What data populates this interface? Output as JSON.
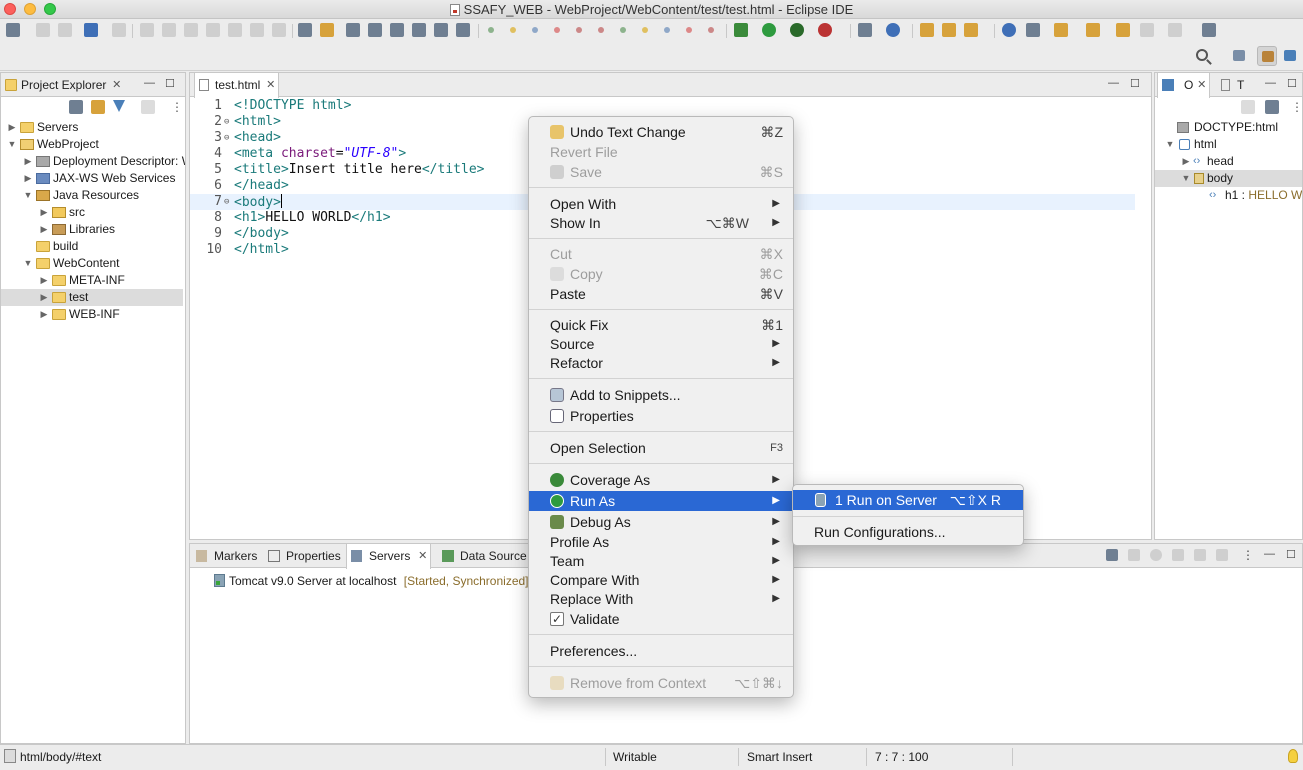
{
  "window": {
    "title": "SSAFY_WEB - WebProject/WebContent/test/test.html - Eclipse IDE"
  },
  "explorer": {
    "tab_label": "Project Explorer",
    "items": [
      {
        "label": "Servers",
        "icon": "folder-icon"
      },
      {
        "label": "WebProject",
        "icon": "project-icon"
      },
      {
        "label": "Deployment Descriptor: WebProject",
        "icon": "deployment-descriptor-icon"
      },
      {
        "label": "JAX-WS Web Services",
        "icon": "web-services-icon"
      },
      {
        "label": "Java Resources",
        "icon": "java-resources-icon"
      },
      {
        "label": "src",
        "icon": "source-folder-icon"
      },
      {
        "label": "Libraries",
        "icon": "libraries-icon"
      },
      {
        "label": "build",
        "icon": "folder-icon"
      },
      {
        "label": "WebContent",
        "icon": "folder-icon"
      },
      {
        "label": "META-INF",
        "icon": "folder-icon"
      },
      {
        "label": "test",
        "icon": "folder-icon"
      },
      {
        "label": "WEB-INF",
        "icon": "folder-icon"
      }
    ]
  },
  "editor": {
    "tab_label": "test.html",
    "line_numbers": [
      "1",
      "2",
      "3",
      "4",
      "5",
      "6",
      "7",
      "8",
      "9",
      "10"
    ],
    "lines": [
      {
        "t1": "<!DOCTYPE html>"
      },
      {
        "t1": "<html>"
      },
      {
        "t1": "<head>"
      },
      {
        "t1": "<meta ",
        "a1": "charset",
        "t2": "=",
        "s1": "\"UTF-8\"",
        "t3": ">"
      },
      {
        "t1": "<title>",
        "x1": "Insert title here",
        "t2": "</title>"
      },
      {
        "t1": "</head>"
      },
      {
        "t1": "<body>"
      },
      {
        "t1": "<h1>",
        "x1": "HELLO WORLD",
        "t2": "</h1>"
      },
      {
        "t1": "</body>"
      },
      {
        "t1": "</html>"
      }
    ]
  },
  "outline": {
    "tab1": "O",
    "tab2": "T",
    "items": [
      {
        "label": "DOCTYPE:html"
      },
      {
        "label": "html"
      },
      {
        "label": "head"
      },
      {
        "label": "body"
      },
      {
        "label": "h1 : ",
        "value": "HELLO WORLD"
      }
    ]
  },
  "bottom": {
    "tabs": [
      "Markers",
      "Properties",
      "Servers",
      "Data Source Explorer"
    ],
    "server": {
      "name": "Tomcat v9.0 Server at localhost",
      "status": "[Started, Synchronized]"
    }
  },
  "statusbar": {
    "path": "html/body/#text",
    "mode": "Writable",
    "insert": "Smart Insert",
    "position": "7 : 7 : 100"
  },
  "context_menu": {
    "items": [
      {
        "label": "Undo Text Change",
        "shortcut": "⌘Z"
      },
      {
        "label": "Revert File"
      },
      {
        "label": "Save",
        "shortcut": "⌘S"
      },
      {
        "label": "Open With"
      },
      {
        "label": "Show In",
        "shortcut": "⌥⌘W"
      },
      {
        "label": "Cut",
        "shortcut": "⌘X"
      },
      {
        "label": "Copy",
        "shortcut": "⌘C"
      },
      {
        "label": "Paste",
        "shortcut": "⌘V"
      },
      {
        "label": "Quick Fix",
        "shortcut": "⌘1"
      },
      {
        "label": "Source"
      },
      {
        "label": "Refactor"
      },
      {
        "label": "Add to Snippets..."
      },
      {
        "label": "Properties"
      },
      {
        "label": "Open Selection",
        "shortcut": "F3"
      },
      {
        "label": "Coverage As"
      },
      {
        "label": "Run As"
      },
      {
        "label": "Debug As"
      },
      {
        "label": "Profile As"
      },
      {
        "label": "Team"
      },
      {
        "label": "Compare With"
      },
      {
        "label": "Replace With"
      },
      {
        "label": "Validate"
      },
      {
        "label": "Preferences..."
      },
      {
        "label": "Remove from Context",
        "shortcut": "⌥⇧⌘↓"
      }
    ]
  },
  "submenu": {
    "items": [
      {
        "label": "1 Run on Server",
        "shortcut": "⌥⇧X R"
      },
      {
        "label": "Run Configurations..."
      }
    ]
  },
  "colors": {
    "selection": "#2a68d4",
    "tag": "#1a7a7a",
    "attr": "#7a1a7a",
    "string": "#2a00ff",
    "status": "#8a6d2c"
  }
}
